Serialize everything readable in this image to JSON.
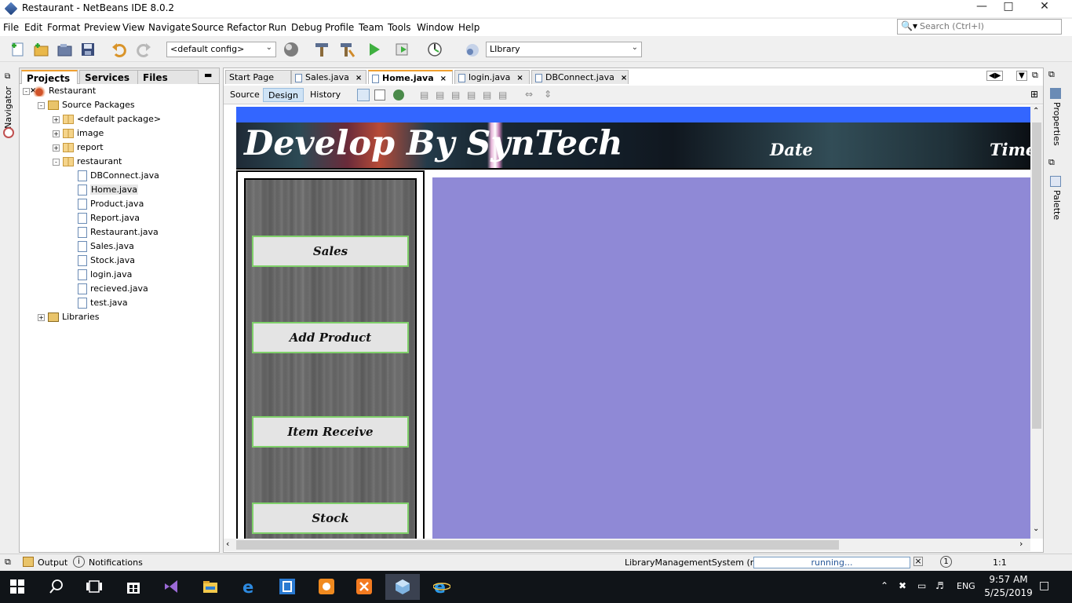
{
  "window": {
    "title": "Restaurant - NetBeans IDE 8.0.2"
  },
  "menu": [
    "File",
    "Edit",
    "Format",
    "Preview",
    "View",
    "Navigate",
    "Source",
    "Refactor",
    "Run",
    "Debug",
    "Profile",
    "Team",
    "Tools",
    "Window",
    "Help"
  ],
  "search": {
    "placeholder": "Search (Ctrl+I)"
  },
  "toolbar": {
    "config_value": "<default config>",
    "project_value": "LIbrary"
  },
  "left_panel": {
    "tabs": [
      "Projects",
      "Services",
      "Files"
    ],
    "tree": [
      {
        "label": "Restaurant",
        "level": 0,
        "type": "project",
        "expander": "-"
      },
      {
        "label": "Source Packages",
        "level": 1,
        "type": "folder",
        "expander": "-"
      },
      {
        "label": "<default package>",
        "level": 2,
        "type": "package",
        "expander": "+"
      },
      {
        "label": "image",
        "level": 2,
        "type": "package",
        "expander": "+"
      },
      {
        "label": "report",
        "level": 2,
        "type": "package",
        "expander": "+"
      },
      {
        "label": "restaurant",
        "level": 2,
        "type": "package",
        "expander": "-"
      },
      {
        "label": "DBConnect.java",
        "level": 3,
        "type": "java"
      },
      {
        "label": "Home.java",
        "level": 3,
        "type": "java",
        "selected": true
      },
      {
        "label": "Product.java",
        "level": 3,
        "type": "java"
      },
      {
        "label": "Report.java",
        "level": 3,
        "type": "java"
      },
      {
        "label": "Restaurant.java",
        "level": 3,
        "type": "java"
      },
      {
        "label": "Sales.java",
        "level": 3,
        "type": "java"
      },
      {
        "label": "Stock.java",
        "level": 3,
        "type": "java"
      },
      {
        "label": "login.java",
        "level": 3,
        "type": "java"
      },
      {
        "label": "recieved.java",
        "level": 3,
        "type": "java"
      },
      {
        "label": "test.java",
        "level": 3,
        "type": "java"
      },
      {
        "label": "Libraries",
        "level": 1,
        "type": "library",
        "expander": "+"
      }
    ]
  },
  "left_strip": {
    "navigator_label": "Navigator"
  },
  "editor": {
    "tabs": [
      {
        "label": "Start Page",
        "active": false
      },
      {
        "label": "Sales.java",
        "active": false
      },
      {
        "label": "Home.java",
        "active": true
      },
      {
        "label": "login.java",
        "active": false
      },
      {
        "label": "DBConnect.java",
        "active": false
      }
    ],
    "modes": [
      "Source",
      "Design",
      "History"
    ],
    "active_mode": "Design"
  },
  "form": {
    "banner_title": "Develop By SynTech",
    "date_label": "Date",
    "time_label": "Time",
    "nav_buttons": [
      "Sales",
      "Add Product",
      "Item Receive",
      "Stock"
    ],
    "colors": {
      "top_bar": "#3366ff",
      "content_bg": "#8f89d6",
      "button_border": "#7fd06a"
    }
  },
  "right_strip": {
    "properties_label": "Properties",
    "palette_label": "Palette"
  },
  "status": {
    "output_label": "Output",
    "notifications_label": "Notifications",
    "process": "LibraryManagementSystem (run)",
    "progress_text": "running...",
    "caret_pos": "1:1"
  },
  "taskbar": {
    "language": "ENG",
    "time": "9:57 AM",
    "date": "5/25/2019"
  }
}
